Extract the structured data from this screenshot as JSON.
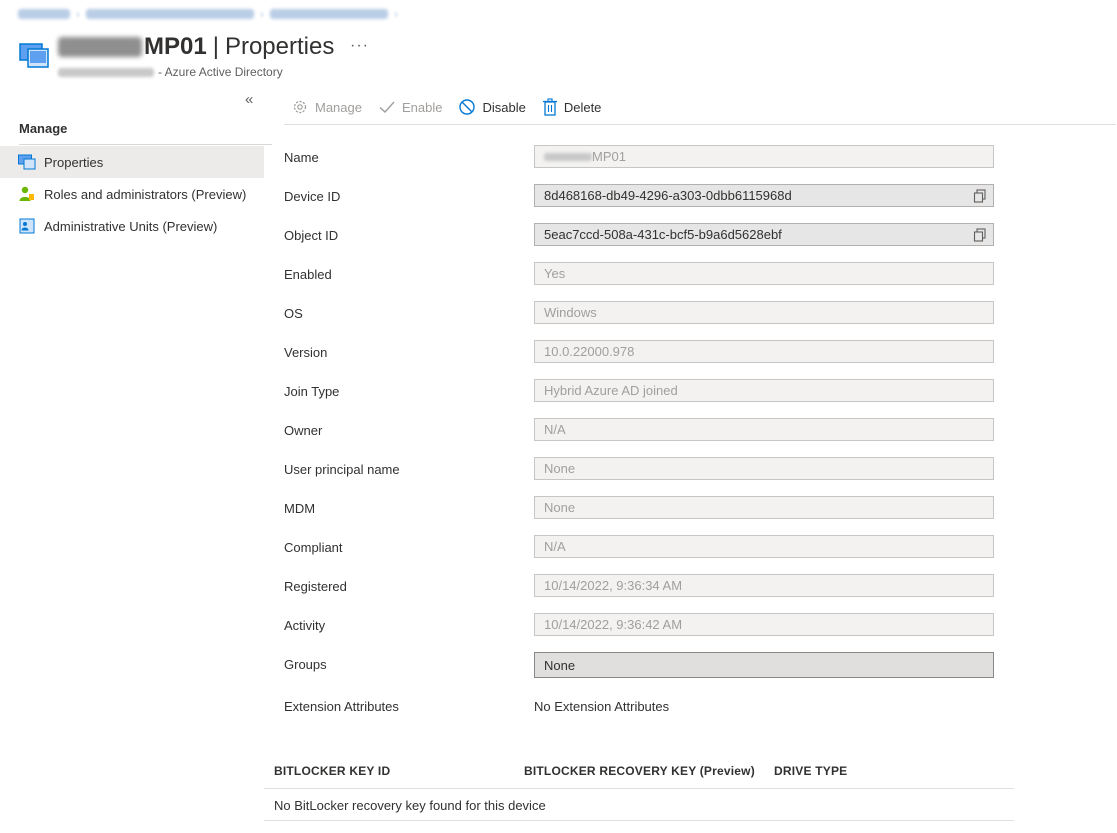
{
  "header": {
    "title_suffix": "MP01",
    "title_separator": "|",
    "title_section": "Properties",
    "more_label": "···",
    "subtitle_suffix": "- Azure Active Directory"
  },
  "sidebar": {
    "collapse_label": "«",
    "heading": "Manage",
    "items": [
      {
        "label": "Properties",
        "icon": "device-icon",
        "active": true
      },
      {
        "label": "Roles and administrators (Preview)",
        "icon": "user-role-icon",
        "active": false
      },
      {
        "label": "Administrative Units (Preview)",
        "icon": "admin-units-icon",
        "active": false
      }
    ]
  },
  "toolbar": {
    "manage_label": "Manage",
    "enable_label": "Enable",
    "disable_label": "Disable",
    "delete_label": "Delete"
  },
  "properties": {
    "name": {
      "label": "Name",
      "value_suffix": "MP01"
    },
    "device_id": {
      "label": "Device ID",
      "value": "8d468168-db49-4296-a303-0dbb6115968d"
    },
    "object_id": {
      "label": "Object ID",
      "value": "5eac7ccd-508a-431c-bcf5-b9a6d5628ebf"
    },
    "enabled": {
      "label": "Enabled",
      "value": "Yes"
    },
    "os": {
      "label": "OS",
      "value": "Windows"
    },
    "version": {
      "label": "Version",
      "value": "10.0.22000.978"
    },
    "join_type": {
      "label": "Join Type",
      "value": "Hybrid Azure AD joined"
    },
    "owner": {
      "label": "Owner",
      "value": "N/A"
    },
    "upn": {
      "label": "User principal name",
      "value": "None"
    },
    "mdm": {
      "label": "MDM",
      "value": "None"
    },
    "compliant": {
      "label": "Compliant",
      "value": "N/A"
    },
    "registered": {
      "label": "Registered",
      "value": "10/14/2022, 9:36:34 AM"
    },
    "activity": {
      "label": "Activity",
      "value": "10/14/2022, 9:36:42 AM"
    },
    "groups": {
      "label": "Groups",
      "value": "None"
    },
    "extension_attributes": {
      "label": "Extension Attributes",
      "value": "No Extension Attributes"
    }
  },
  "bitlocker": {
    "columns": [
      "BITLOCKER KEY ID",
      "BITLOCKER RECOVERY KEY (Preview)",
      "DRIVE TYPE"
    ],
    "empty_message": "No BitLocker recovery key found for this device"
  },
  "colors": {
    "accent": "#0078d4",
    "disabled_text": "#a19f9d",
    "field_background": "#f3f2f1",
    "active_nav": "#edebe9"
  }
}
